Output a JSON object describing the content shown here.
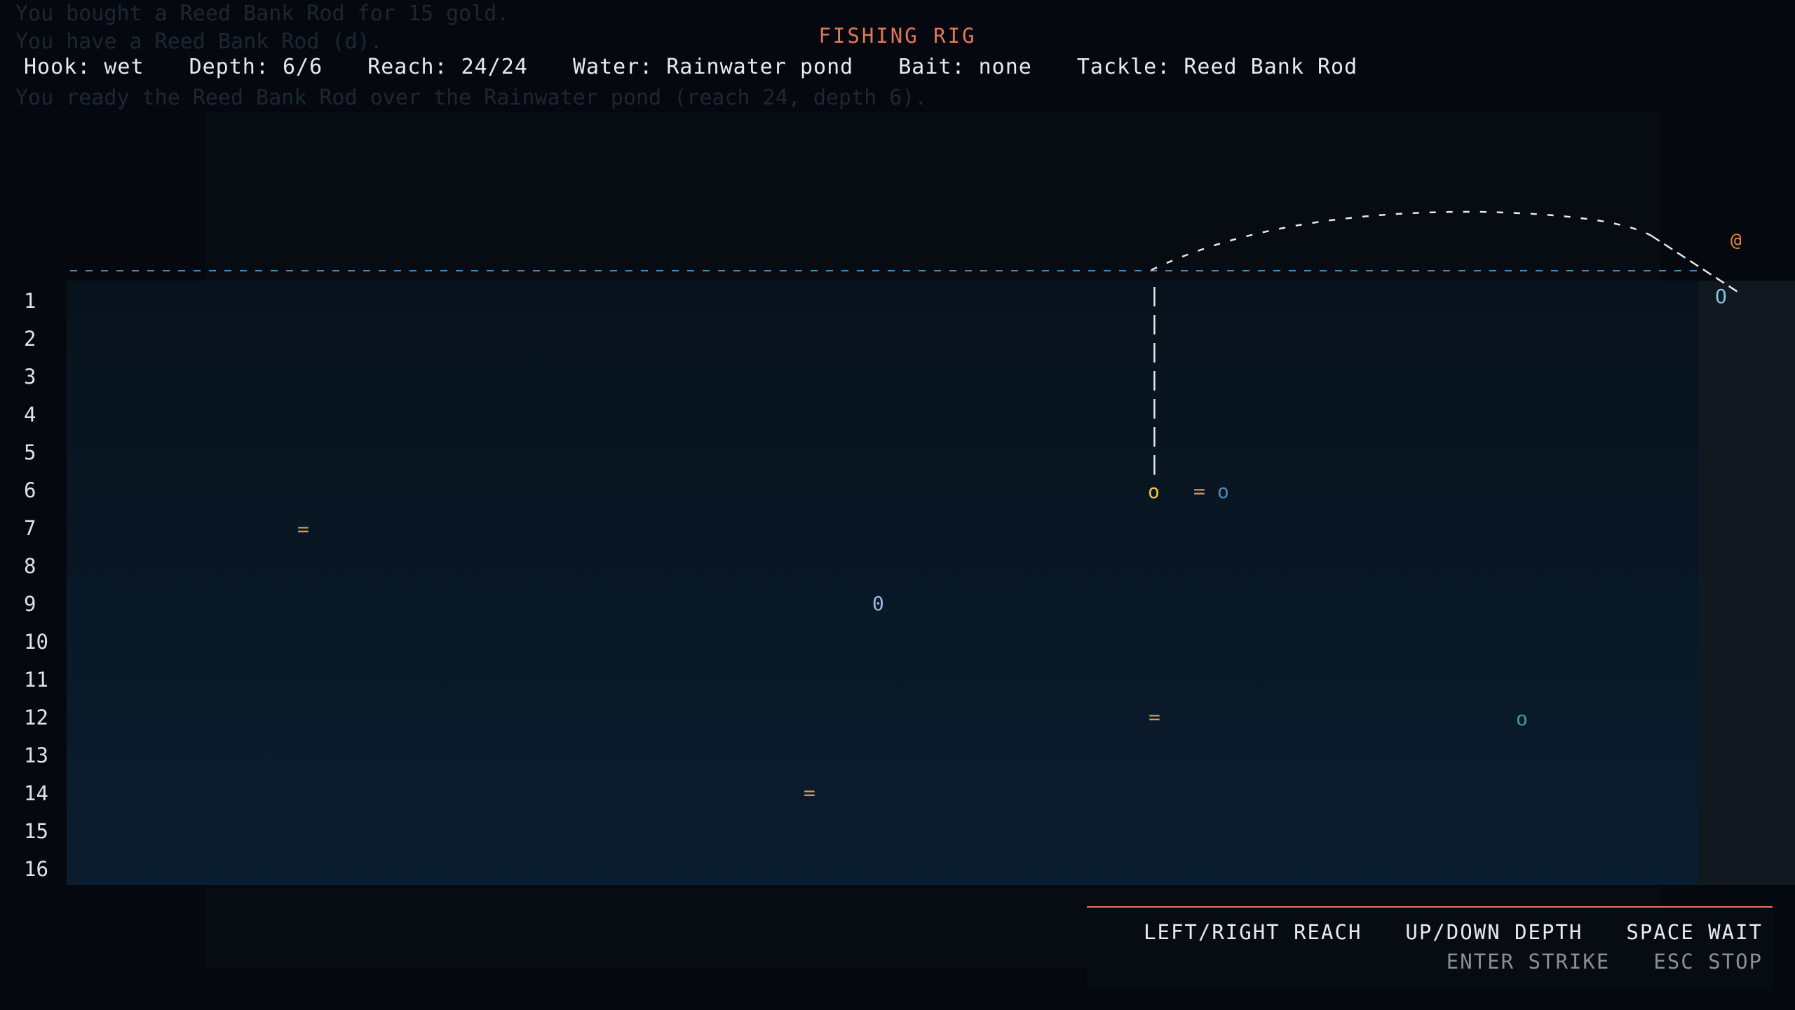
{
  "log": [
    "You bought a Reed Bank Rod for 15 gold.",
    "You have a Reed Bank Rod (d).",
    "You ready the Reed Bank Rod over the Rainwater pond (reach 24, depth 6)."
  ],
  "panel_title": "FISHING RIG",
  "status": {
    "hook": "Hook: wet",
    "depth": "Depth: 6/6",
    "reach": "Reach: 24/24",
    "water": "Water: Rainwater pond",
    "bait": "Bait: none",
    "tackle": "Tackle: Reed Bank Rod"
  },
  "depth_rows": [
    "1",
    "2",
    "3",
    "4",
    "5",
    "6",
    "7",
    "8",
    "9",
    "10",
    "11",
    "12",
    "13",
    "14",
    "15",
    "16"
  ],
  "glyphs": {
    "player": "@",
    "boat": "O",
    "hook": "o",
    "line": "|",
    "fish_bright": "0",
    "fish_small": "o",
    "weed": "="
  },
  "colors": {
    "accent": "#e0765a",
    "water_surface": "#4d88b5",
    "hook": "#f0c24a",
    "weed": "#d39a55",
    "fish": "#9fb7e0",
    "fish_teal": "#3e9e9a",
    "player": "#e08a3a"
  },
  "controls": {
    "reach": "LEFT/RIGHT REACH",
    "depth": "UP/DOWN DEPTH",
    "wait": "SPACE WAIT",
    "strike": "ENTER STRIKE",
    "stop": "ESC STOP"
  }
}
